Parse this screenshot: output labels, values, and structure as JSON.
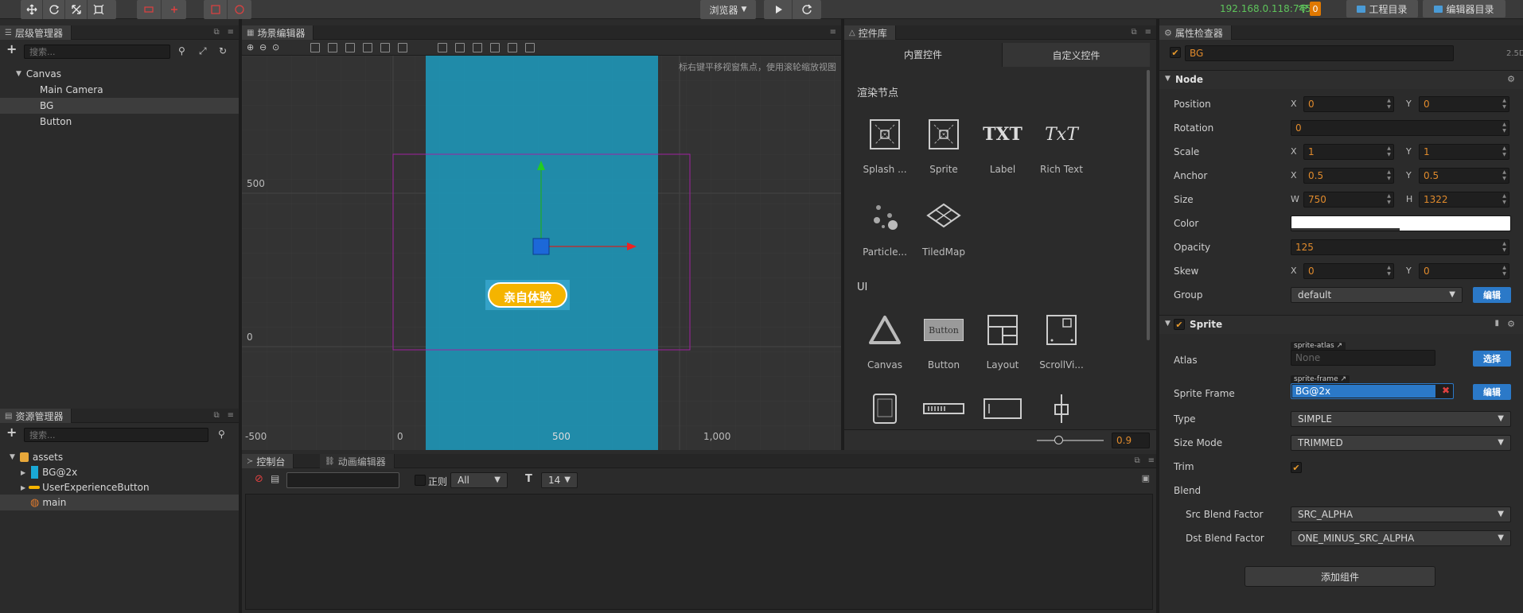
{
  "topbar": {
    "tools": [
      "move-tool",
      "rotate-tool",
      "scale-tool",
      "rect-tool"
    ],
    "browser_label": "浏览器",
    "ip": "192.168.0.118:7456",
    "badge": "0",
    "project_dir_label": "工程目录",
    "editor_dir_label": "编辑器目录"
  },
  "hierarchy": {
    "title": "层级管理器",
    "search_placeholder": "搜索...",
    "items": [
      {
        "label": "Canvas"
      },
      {
        "label": "Main Camera"
      },
      {
        "label": "BG"
      },
      {
        "label": "Button"
      }
    ]
  },
  "assets": {
    "title": "资源管理器",
    "search_placeholder": "搜索...",
    "items": [
      {
        "label": "assets"
      },
      {
        "label": "BG@2x"
      },
      {
        "label": "UserExperienceButton"
      },
      {
        "label": "main"
      }
    ]
  },
  "scene": {
    "title": "场景编辑器",
    "hint": "使用鼠标右键平移视窗焦点，使用滚轮缩放视图",
    "hint_visible": "标右键平移视窗焦点，使用滚轮缩放视图",
    "ruler_y": [
      "500",
      "0",
      "-500"
    ],
    "ruler_x": [
      "0",
      "500",
      "1,000"
    ],
    "button_text": "亲自体验"
  },
  "console": {
    "tab_console": "控制台",
    "tab_animation": "动画编辑器",
    "regex_label": "正则",
    "filter_value": "All",
    "font_size": "14"
  },
  "library": {
    "title": "控件库",
    "tab_builtin": "内置控件",
    "tab_custom": "自定义控件",
    "section_render": "渲染节点",
    "render_items": [
      "Splash ...",
      "Sprite",
      "Label",
      "Rich Text",
      "Particle...",
      "TiledMap"
    ],
    "section_ui": "UI",
    "ui_items": [
      "Canvas",
      "Button",
      "Layout",
      "ScrollVi..."
    ],
    "zoom_value": "0.9",
    "icon_text_label": "TXT",
    "icon_text_rich": "TxT",
    "icon_text_button": "Button"
  },
  "inspector": {
    "title": "属性检查器",
    "node_name": "BG",
    "mode_label": "2.5D",
    "node_section": "Node",
    "position": {
      "label": "Position",
      "x": "0",
      "y": "0"
    },
    "rotation": {
      "label": "Rotation",
      "value": "0"
    },
    "scale": {
      "label": "Scale",
      "x": "1",
      "y": "1"
    },
    "anchor": {
      "label": "Anchor",
      "x": "0.5",
      "y": "0.5"
    },
    "size": {
      "label": "Size",
      "w": "750",
      "h": "1322"
    },
    "color": {
      "label": "Color",
      "value": "#ffffff"
    },
    "opacity": {
      "label": "Opacity",
      "value": "125"
    },
    "skew": {
      "label": "Skew",
      "x": "0",
      "y": "0"
    },
    "group": {
      "label": "Group",
      "value": "default",
      "edit": "编辑"
    },
    "sprite_section": "Sprite",
    "atlas": {
      "label": "Atlas",
      "tag": "sprite-atlas",
      "placeholder": "None",
      "select": "选择"
    },
    "sprite_frame": {
      "label": "Sprite Frame",
      "tag": "sprite-frame",
      "value": "BG@2x",
      "edit": "编辑"
    },
    "type": {
      "label": "Type",
      "value": "SIMPLE"
    },
    "size_mode": {
      "label": "Size Mode",
      "value": "TRIMMED"
    },
    "trim": {
      "label": "Trim"
    },
    "blend": {
      "label": "Blend"
    },
    "src_blend": {
      "label": "Src Blend Factor",
      "value": "SRC_ALPHA"
    },
    "dst_blend": {
      "label": "Dst Blend Factor",
      "value": "ONE_MINUS_SRC_ALPHA"
    },
    "add_component": "添加组件"
  },
  "colors": {
    "accent_orange": "#e08a2c",
    "accent_blue": "#2b79c8",
    "scene_bg": "#2090b0",
    "button_yellow": "#f5b400",
    "ip_green": "#5ec45b"
  }
}
